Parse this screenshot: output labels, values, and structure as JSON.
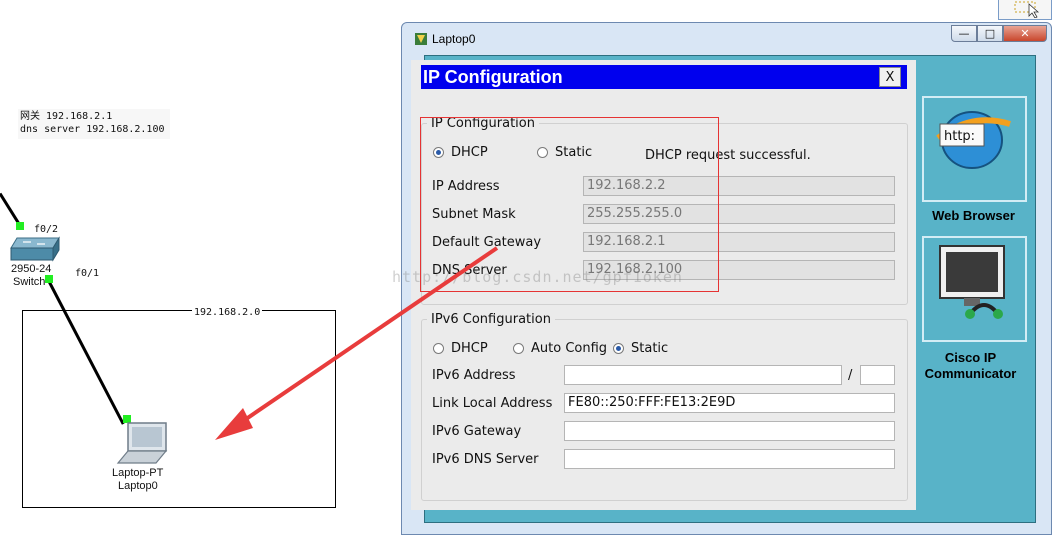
{
  "canvas": {
    "note_line1": "网关 192.168.2.1",
    "note_line2": "dns server 192.168.2.100",
    "switch_port_top": "f0/2",
    "switch_port_bottom": "f0/1",
    "switch_model": "2950-24",
    "switch_name": "Switch",
    "area_label": "192.168.2.0",
    "laptop_model": "Laptop-PT",
    "laptop_name": "Laptop0"
  },
  "window": {
    "title": "Laptop0",
    "minimize": "—",
    "maximize": "□",
    "close": "✕"
  },
  "dialog": {
    "title": "IP Configuration",
    "close_label": "X",
    "ipv4": {
      "group_label": "IP Configuration",
      "dhcp_label": "DHCP",
      "static_label": "Static",
      "mode": "DHCP",
      "status": "DHCP request successful.",
      "fields": [
        {
          "label": "IP Address",
          "value": "192.168.2.2"
        },
        {
          "label": "Subnet Mask",
          "value": "255.255.255.0"
        },
        {
          "label": "Default Gateway",
          "value": "192.168.2.1"
        },
        {
          "label": "DNS Server",
          "value": "192.168.2.100"
        }
      ]
    },
    "ipv6": {
      "group_label": "IPv6 Configuration",
      "dhcp_label": "DHCP",
      "auto_label": "Auto Config",
      "static_label": "Static",
      "mode": "Static",
      "address_label": "IPv6 Address",
      "address_value": "",
      "prefix_sep": "/",
      "prefix_value": "",
      "link_local_label": "Link Local Address",
      "link_local_value": "FE80::250:FFF:FE13:2E9D",
      "gateway_label": "IPv6 Gateway",
      "gateway_value": "",
      "dns_label": "IPv6 DNS Server",
      "dns_value": ""
    }
  },
  "sidebar": {
    "browser_label": "Web Browser",
    "browser_icon_text": "http:",
    "cisco_label_1": "Cisco IP",
    "cisco_label_2": "Communicator"
  },
  "watermark": "http://blog.csdn.net/gpf1oken",
  "colors": {
    "dialog_header": "#0000ee",
    "panel_teal": "#58b3c8",
    "link_dot": "#22ee22",
    "arrow": "#e83c3c"
  }
}
